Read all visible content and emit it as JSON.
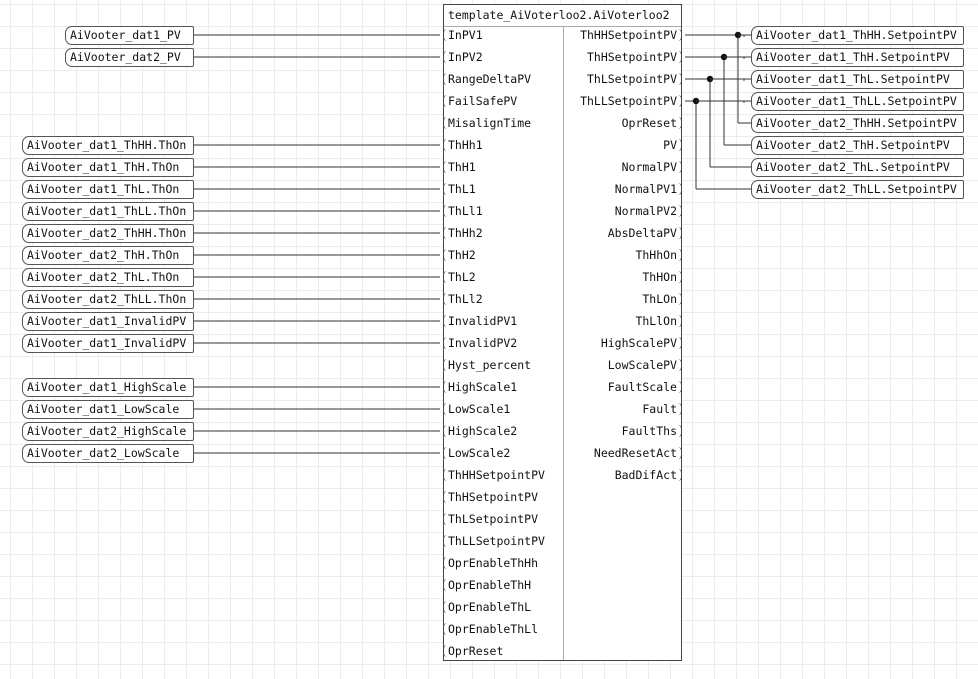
{
  "block": {
    "title": "template_AiVoterloo2.AiVoterloo2",
    "inputs": [
      "InPV1",
      "InPV2",
      "RangeDeltaPV",
      "FailSafePV",
      "MisalignTime",
      "ThHh1",
      "ThH1",
      "ThL1",
      "ThLl1",
      "ThHh2",
      "ThH2",
      "ThL2",
      "ThLl2",
      "InvalidPV1",
      "InvalidPV2",
      "Hyst_percent",
      "HighScale1",
      "LowScale1",
      "HighScale2",
      "LowScale2",
      "ThHHSetpointPV",
      "ThHSetpointPV",
      "ThLSetpointPV",
      "ThLLSetpointPV",
      "OprEnableThHh",
      "OprEnableThH",
      "OprEnableThL",
      "OprEnableThLl",
      "OprReset"
    ],
    "outputs": [
      "ThHHSetpointPV",
      "ThHSetpointPV",
      "ThLSetpointPV",
      "ThLLSetpointPV",
      "OprReset",
      "PV",
      "NormalPV",
      "NormalPV1",
      "NormalPV2",
      "AbsDeltaPV",
      "ThHhOn",
      "ThHOn",
      "ThLOn",
      "ThLlOn",
      "HighScalePV",
      "LowScalePV",
      "FaultScale",
      "Fault",
      "FaultThs",
      "NeedResetAct",
      "BadDifAct"
    ]
  },
  "input_tags": [
    {
      "label": "AiVooter_dat1_PV",
      "pin": 0
    },
    {
      "label": "AiVooter_dat2_PV",
      "pin": 1
    },
    {
      "label": "AiVooter_dat1_ThHH.ThOn",
      "pin": 5
    },
    {
      "label": "AiVooter_dat1_ThH.ThOn",
      "pin": 6
    },
    {
      "label": "AiVooter_dat1_ThL.ThOn",
      "pin": 7
    },
    {
      "label": "AiVooter_dat1_ThLL.ThOn",
      "pin": 8
    },
    {
      "label": "AiVooter_dat2_ThHH.ThOn",
      "pin": 9
    },
    {
      "label": "AiVooter_dat2_ThH.ThOn",
      "pin": 10
    },
    {
      "label": "AiVooter_dat2_ThL.ThOn",
      "pin": 11
    },
    {
      "label": "AiVooter_dat2_ThLL.ThOn",
      "pin": 12
    },
    {
      "label": "AiVooter_dat1_InvalidPV",
      "pin": 13
    },
    {
      "label": "AiVooter_dat1_InvalidPV",
      "pin": 14
    },
    {
      "label": "AiVooter_dat1_HighScale",
      "pin": 16
    },
    {
      "label": "AiVooter_dat1_LowScale",
      "pin": 17
    },
    {
      "label": "AiVooter_dat2_HighScale",
      "pin": 18
    },
    {
      "label": "AiVooter_dat2_LowScale",
      "pin": 19
    }
  ],
  "output_tags": [
    {
      "label": "AiVooter_dat1_ThHH.SetpointPV",
      "src": 0
    },
    {
      "label": "AiVooter_dat1_ThH.SetpointPV",
      "src": 1
    },
    {
      "label": "AiVooter_dat1_ThL.SetpointPV",
      "src": 2
    },
    {
      "label": "AiVooter_dat1_ThLL.SetpointPV",
      "src": 3
    },
    {
      "label": "AiVooter_dat2_ThHH.SetpointPV",
      "src": 0
    },
    {
      "label": "AiVooter_dat2_ThH.SetpointPV",
      "src": 1
    },
    {
      "label": "AiVooter_dat2_ThL.SetpointPV",
      "src": 2
    },
    {
      "label": "AiVooter_dat2_ThLL.SetpointPV",
      "src": 3
    }
  ]
}
